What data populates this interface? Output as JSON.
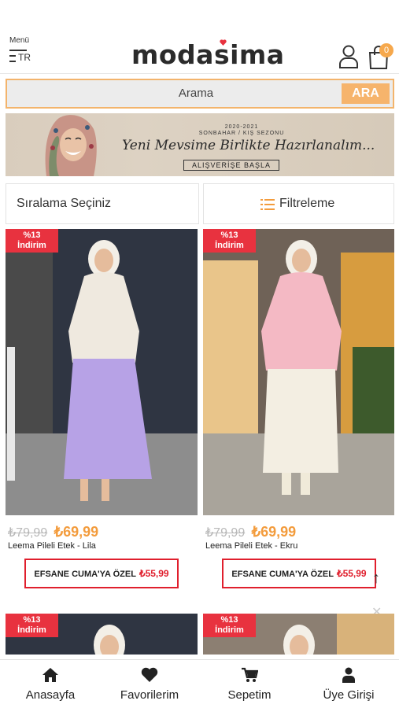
{
  "header": {
    "menu_label": "Menü",
    "language": "TR",
    "logo_text": "modasima",
    "cart_count": "0",
    "accent_color": "#f6a84c"
  },
  "search": {
    "placeholder": "Arama",
    "button_label": "ARA"
  },
  "banner": {
    "season_year": "2020-2021",
    "season_text": "SONBAHAR / KIŞ SEZONU",
    "headline": "Yeni Mevsime Birlikte Hazırlanalım...",
    "cta": "ALIŞVERİŞE BAŞLA"
  },
  "controls": {
    "sort_label": "Sıralama Seçiniz",
    "filter_label": "Filtreleme"
  },
  "products": [
    {
      "discount_line1": "%13",
      "discount_line2": "İndirim",
      "old_price": "₺79,99",
      "new_price": "₺69,99",
      "name": "Leema Pileli Etek - Lila",
      "promo_label": "EFSANE CUMA'YA ÖZEL",
      "promo_price": "₺55,99",
      "skirt_color": "#b7a2e6",
      "top_color": "#efe9df"
    },
    {
      "discount_line1": "%13",
      "discount_line2": "İndirim",
      "old_price": "₺79,99",
      "new_price": "₺69,99",
      "name": "Leema Pileli Etek - Ekru",
      "promo_label": "EFSANE CUMA'YA ÖZEL",
      "promo_price": "₺55,99",
      "skirt_color": "#f3eee2",
      "top_color": "#f4b9c4"
    },
    {
      "discount_line1": "%13",
      "discount_line2": "İndirim"
    },
    {
      "discount_line1": "%13",
      "discount_line2": "İndirim"
    }
  ],
  "bottom_nav": [
    {
      "label": "Anasayfa",
      "icon": "home-icon"
    },
    {
      "label": "Favorilerim",
      "icon": "heart-icon"
    },
    {
      "label": "Sepetim",
      "icon": "cart-icon"
    },
    {
      "label": "Üye Girişi",
      "icon": "user-icon"
    }
  ]
}
